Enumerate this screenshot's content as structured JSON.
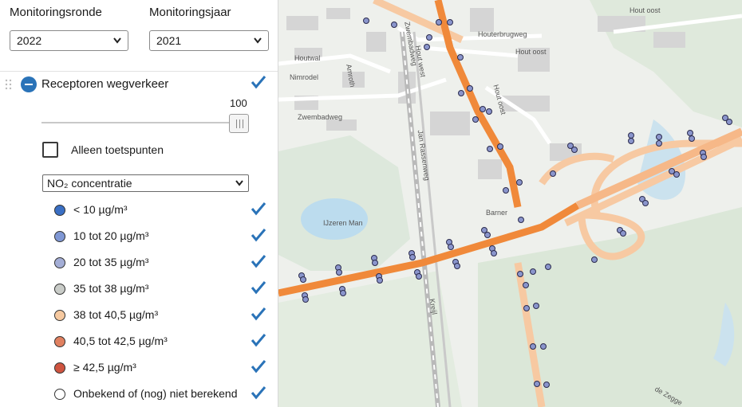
{
  "panel": {
    "round_label": "Monitoringsronde",
    "round_value": "2022",
    "year_label": "Monitoringsjaar",
    "year_value": "2021",
    "layer_title": "Receptoren wegverkeer",
    "opacity_value": "100",
    "checkbox_label": "Alleen toetspunten",
    "substance_select": "NO₂ concentratie",
    "legend": [
      {
        "label": "< 10 µg/m³",
        "color": "#3a6fc4"
      },
      {
        "label": "10 tot 20 µg/m³",
        "color": "#7f97d4"
      },
      {
        "label": "20 tot 35 µg/m³",
        "color": "#a4aed6"
      },
      {
        "label": "35 tot 38 µg/m³",
        "color": "#c9ccc8"
      },
      {
        "label": "38 tot 40,5 µg/m³",
        "color": "#f6c9a0"
      },
      {
        "label": "40,5 tot 42,5 µg/m³",
        "color": "#e08060"
      },
      {
        "label": "≥ 42,5 µg/m³",
        "color": "#cf5440"
      },
      {
        "label": "Onbekend of (nog) niet berekend",
        "color": "#ffffff"
      }
    ],
    "accent_color": "#2a73b8"
  },
  "map": {
    "street_labels": [
      "Zwembadweg",
      "Hout west",
      "Houtwal",
      "Houterbrugweg",
      "Hout oost",
      "Hout oost",
      "Nimrodel",
      "Amroth",
      "Zwembadweg",
      "Jan Rassenweg",
      "IJzeren Man",
      "Barner",
      "Kreijl",
      "de Zegge",
      "Hout oost"
    ]
  }
}
